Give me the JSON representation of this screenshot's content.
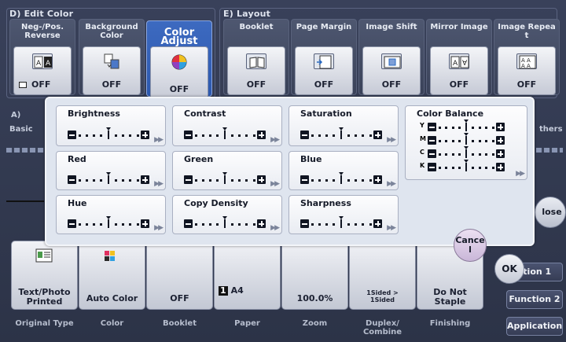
{
  "edit_color": {
    "title": "D)  Edit Color"
  },
  "layout": {
    "title": "E)  Layout"
  },
  "top_tiles": [
    {
      "label": "Neg-/Pos.\nReverse",
      "value": "OFF"
    },
    {
      "label": "Background\nColor",
      "value": "OFF"
    },
    {
      "label": "Color Adjust",
      "value": "OFF"
    },
    {
      "label": "Booklet",
      "value": "OFF"
    },
    {
      "label": "Page Margin",
      "value": "OFF"
    },
    {
      "label": "Image Shift",
      "value": "OFF"
    },
    {
      "label": "Mirror Image",
      "value": "OFF"
    },
    {
      "label": "Image Repea\nt",
      "value": "OFF"
    }
  ],
  "left_side": {
    "a": "A)",
    "basic": "Basic"
  },
  "right_side": {
    "others": "thers"
  },
  "adjust": {
    "brightness": "Brightness",
    "contrast": "Contrast",
    "saturation": "Saturation",
    "color_balance": "Color Balance",
    "red": "Red",
    "green": "Green",
    "blue": "Blue",
    "hue": "Hue",
    "copy_density": "Copy Density",
    "sharpness": "Sharpness",
    "cb_channels": [
      "Y",
      "M",
      "C",
      "K"
    ],
    "more_icon": "double-chevron-right-icon"
  },
  "slider": {
    "levels": 9,
    "value": 0
  },
  "buttons": {
    "cancel": "Cance\nl",
    "ok": "OK",
    "close": "lose"
  },
  "bottom_tiles": [
    {
      "value": "Text/Photo\nPrinted",
      "caption": "Original Type"
    },
    {
      "value": "Auto Color",
      "caption": "Color"
    },
    {
      "value": "OFF",
      "caption": "Booklet"
    },
    {
      "value": "A4",
      "caption": "Paper"
    },
    {
      "value": "100.0%",
      "caption": "Zoom"
    },
    {
      "value": "1Sided >\n1Sided",
      "caption": "Duplex/\nCombine"
    },
    {
      "value": "Do Not\nStaple",
      "caption": "Finishing"
    }
  ],
  "paper_tray": "1",
  "func_buttons": {
    "function1": "ction 1",
    "function2": "Function 2",
    "application": "Application"
  },
  "colors": {
    "accent": "#3060b8",
    "dialog": "#dfe5ef",
    "dark": "#2e3548"
  }
}
